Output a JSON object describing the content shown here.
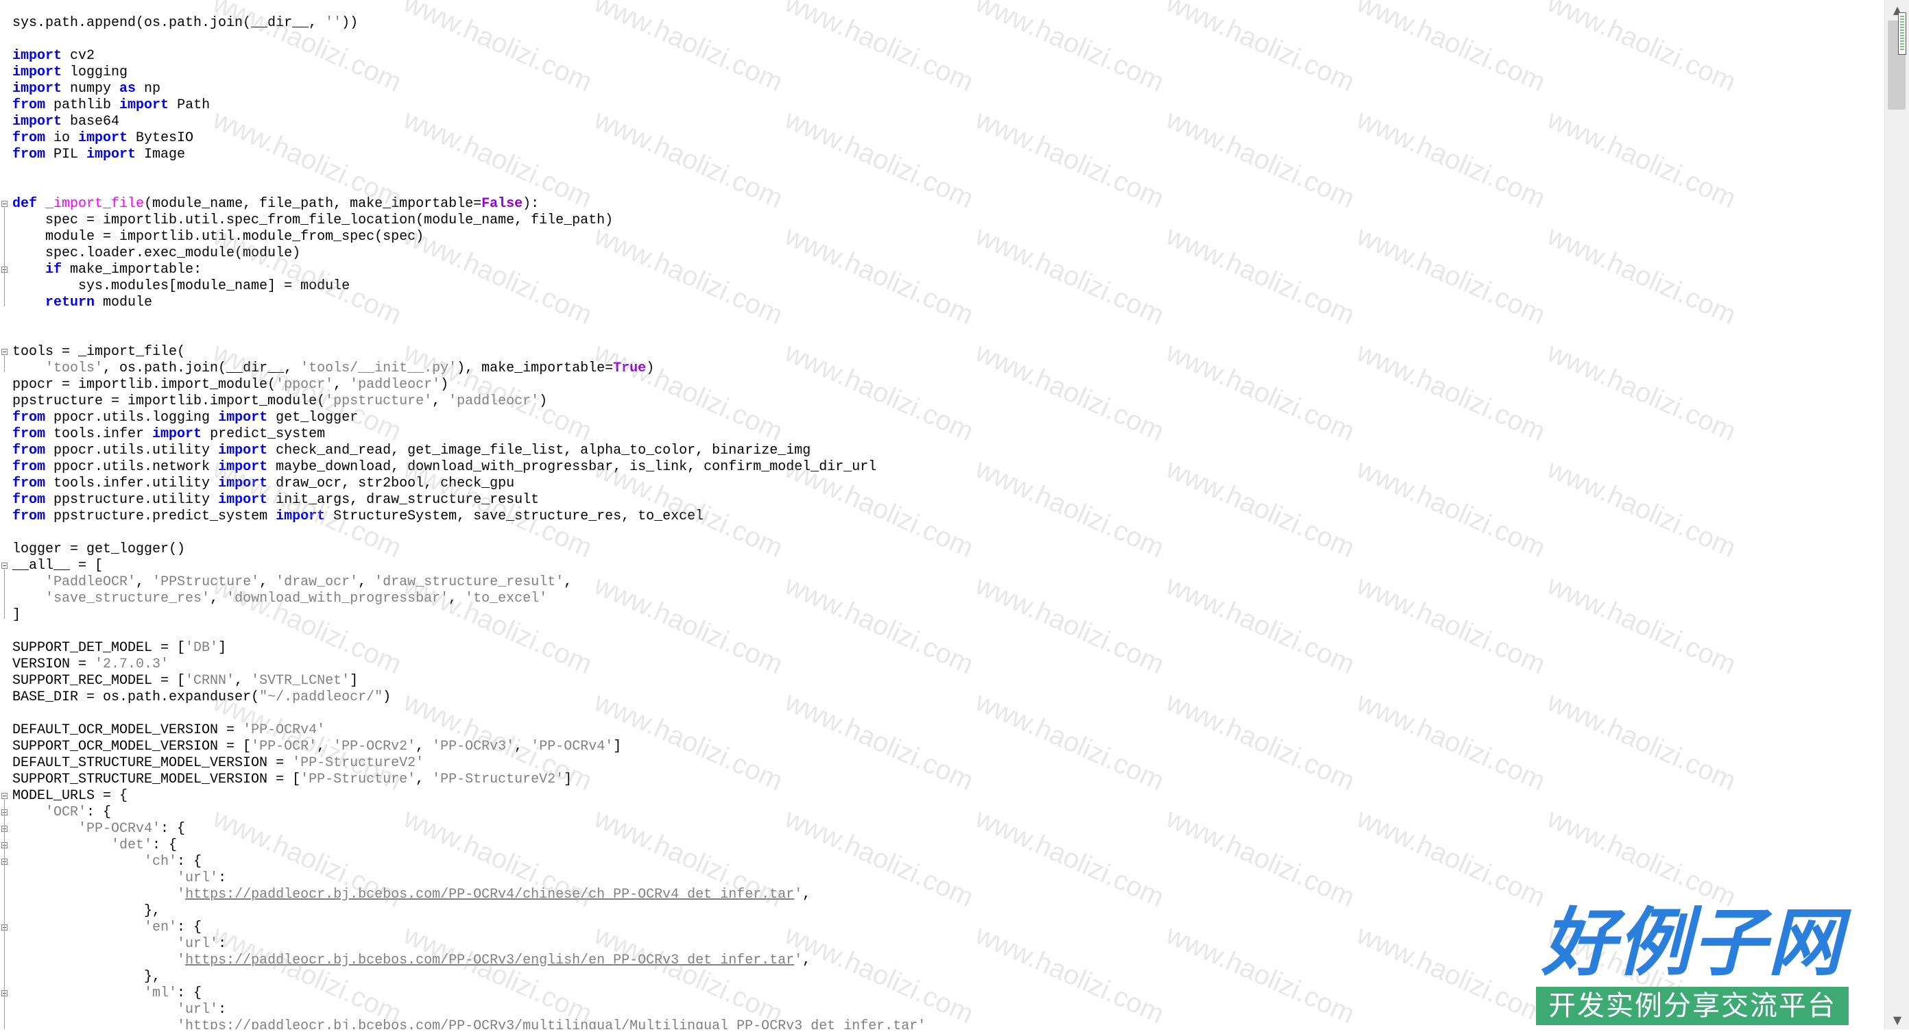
{
  "code_lines": [
    [
      [
        "sys.path.append(os.path.join(__dir__, ",
        ""
      ],
      [
        "''",
        "str"
      ],
      [
        "))",
        ""
      ]
    ],
    [],
    [
      [
        "import",
        "kw"
      ],
      [
        " cv2",
        ""
      ]
    ],
    [
      [
        "import",
        "kw"
      ],
      [
        " logging",
        ""
      ]
    ],
    [
      [
        "import",
        "kw"
      ],
      [
        " numpy ",
        ""
      ],
      [
        "as",
        "kw"
      ],
      [
        " np",
        ""
      ]
    ],
    [
      [
        "from",
        "kw"
      ],
      [
        " pathlib ",
        ""
      ],
      [
        "import",
        "kw"
      ],
      [
        " Path",
        ""
      ]
    ],
    [
      [
        "import",
        "kw"
      ],
      [
        " base64",
        ""
      ]
    ],
    [
      [
        "from",
        "kw"
      ],
      [
        " io ",
        ""
      ],
      [
        "import",
        "kw"
      ],
      [
        " BytesIO",
        ""
      ]
    ],
    [
      [
        "from",
        "kw"
      ],
      [
        " PIL ",
        ""
      ],
      [
        "import",
        "kw"
      ],
      [
        " Image",
        ""
      ]
    ],
    [],
    [],
    [
      [
        "def",
        "kw"
      ],
      [
        " ",
        ""
      ],
      [
        "_import_file",
        "fn"
      ],
      [
        "(module_name, file_path, make_importable=",
        ""
      ],
      [
        "False",
        "kw2"
      ],
      [
        "):",
        ""
      ]
    ],
    [
      [
        "    spec = importlib.util.spec_from_file_location(module_name, file_path)",
        ""
      ]
    ],
    [
      [
        "    module = importlib.util.module_from_spec(spec)",
        ""
      ]
    ],
    [
      [
        "    spec.loader.exec_module(module)",
        ""
      ]
    ],
    [
      [
        "    ",
        ""
      ],
      [
        "if",
        "kw"
      ],
      [
        " make_importable:",
        ""
      ]
    ],
    [
      [
        "        sys.modules[module_name] = module",
        ""
      ]
    ],
    [
      [
        "    ",
        ""
      ],
      [
        "return",
        "kw"
      ],
      [
        " module",
        ""
      ]
    ],
    [],
    [],
    [
      [
        "tools = _import_file(",
        ""
      ]
    ],
    [
      [
        "    ",
        ""
      ],
      [
        "'tools'",
        "str"
      ],
      [
        ", os.path.join(__dir__, ",
        ""
      ],
      [
        "'tools/__init__.py'",
        "str"
      ],
      [
        "), make_importable=",
        ""
      ],
      [
        "True",
        "kw2"
      ],
      [
        ")",
        ""
      ]
    ],
    [
      [
        "ppocr = importlib.import_module(",
        ""
      ],
      [
        "'ppocr'",
        "str"
      ],
      [
        ", ",
        ""
      ],
      [
        "'paddleocr'",
        "str"
      ],
      [
        ")",
        ""
      ]
    ],
    [
      [
        "ppstructure = importlib.import_module(",
        ""
      ],
      [
        "'ppstructure'",
        "str"
      ],
      [
        ", ",
        ""
      ],
      [
        "'paddleocr'",
        "str"
      ],
      [
        ")",
        ""
      ]
    ],
    [
      [
        "from",
        "kw"
      ],
      [
        " ppocr.utils.logging ",
        ""
      ],
      [
        "import",
        "kw"
      ],
      [
        " get_logger",
        ""
      ]
    ],
    [
      [
        "from",
        "kw"
      ],
      [
        " tools.infer ",
        ""
      ],
      [
        "import",
        "kw"
      ],
      [
        " predict_system",
        ""
      ]
    ],
    [
      [
        "from",
        "kw"
      ],
      [
        " ppocr.utils.utility ",
        ""
      ],
      [
        "import",
        "kw"
      ],
      [
        " check_and_read, get_image_file_list, alpha_to_color, binarize_img",
        ""
      ]
    ],
    [
      [
        "from",
        "kw"
      ],
      [
        " ppocr.utils.network ",
        ""
      ],
      [
        "import",
        "kw"
      ],
      [
        " maybe_download, download_with_progressbar, is_link, confirm_model_dir_url",
        ""
      ]
    ],
    [
      [
        "from",
        "kw"
      ],
      [
        " tools.infer.utility ",
        ""
      ],
      [
        "import",
        "kw"
      ],
      [
        " draw_ocr, str2bool, check_gpu",
        ""
      ]
    ],
    [
      [
        "from",
        "kw"
      ],
      [
        " ppstructure.utility ",
        ""
      ],
      [
        "import",
        "kw"
      ],
      [
        " init_args, draw_structure_result",
        ""
      ]
    ],
    [
      [
        "from",
        "kw"
      ],
      [
        " ppstructure.predict_system ",
        ""
      ],
      [
        "import",
        "kw"
      ],
      [
        " StructureSystem, save_structure_res, to_excel",
        ""
      ]
    ],
    [],
    [
      [
        "logger = get_logger()",
        ""
      ]
    ],
    [
      [
        "__all__ = [",
        ""
      ]
    ],
    [
      [
        "    ",
        ""
      ],
      [
        "'PaddleOCR'",
        "str"
      ],
      [
        ", ",
        ""
      ],
      [
        "'PPStructure'",
        "str"
      ],
      [
        ", ",
        ""
      ],
      [
        "'draw_ocr'",
        "str"
      ],
      [
        ", ",
        ""
      ],
      [
        "'draw_structure_result'",
        "str"
      ],
      [
        ",",
        ""
      ]
    ],
    [
      [
        "    ",
        ""
      ],
      [
        "'save_structure_res'",
        "str"
      ],
      [
        ", ",
        ""
      ],
      [
        "'download_with_progressbar'",
        "str"
      ],
      [
        ", ",
        ""
      ],
      [
        "'to_excel'",
        "str"
      ]
    ],
    [
      [
        "]",
        ""
      ]
    ],
    [],
    [
      [
        "SUPPORT_DET_MODEL = [",
        ""
      ],
      [
        "'DB'",
        "str"
      ],
      [
        "]",
        ""
      ]
    ],
    [
      [
        "VERSION = ",
        ""
      ],
      [
        "'2.7.0.3'",
        "str"
      ]
    ],
    [
      [
        "SUPPORT_REC_MODEL = [",
        ""
      ],
      [
        "'CRNN'",
        "str"
      ],
      [
        ", ",
        ""
      ],
      [
        "'SVTR_LCNet'",
        "str"
      ],
      [
        "]",
        ""
      ]
    ],
    [
      [
        "BASE_DIR = os.path.expanduser(",
        ""
      ],
      [
        "\"~/.paddleocr/\"",
        "str"
      ],
      [
        ")",
        ""
      ]
    ],
    [],
    [
      [
        "DEFAULT_OCR_MODEL_VERSION = ",
        ""
      ],
      [
        "'PP-OCRv4'",
        "str"
      ]
    ],
    [
      [
        "SUPPORT_OCR_MODEL_VERSION = [",
        ""
      ],
      [
        "'PP-OCR'",
        "str"
      ],
      [
        ", ",
        ""
      ],
      [
        "'PP-OCRv2'",
        "str"
      ],
      [
        ", ",
        ""
      ],
      [
        "'PP-OCRv3'",
        "str"
      ],
      [
        ", ",
        ""
      ],
      [
        "'PP-OCRv4'",
        "str"
      ],
      [
        "]",
        ""
      ]
    ],
    [
      [
        "DEFAULT_STRUCTURE_MODEL_VERSION = ",
        ""
      ],
      [
        "'PP-StructureV2'",
        "str"
      ]
    ],
    [
      [
        "SUPPORT_STRUCTURE_MODEL_VERSION = [",
        ""
      ],
      [
        "'PP-Structure'",
        "str"
      ],
      [
        ", ",
        ""
      ],
      [
        "'PP-StructureV2'",
        "str"
      ],
      [
        "]",
        ""
      ]
    ],
    [
      [
        "MODEL_URLS = {",
        ""
      ]
    ],
    [
      [
        "    ",
        ""
      ],
      [
        "'OCR'",
        "str"
      ],
      [
        ": {",
        ""
      ]
    ],
    [
      [
        "        ",
        ""
      ],
      [
        "'PP-OCRv4'",
        "str"
      ],
      [
        ": {",
        ""
      ]
    ],
    [
      [
        "            ",
        ""
      ],
      [
        "'det'",
        "str"
      ],
      [
        ": {",
        ""
      ]
    ],
    [
      [
        "                ",
        ""
      ],
      [
        "'ch'",
        "str"
      ],
      [
        ": {",
        ""
      ]
    ],
    [
      [
        "                    ",
        ""
      ],
      [
        "'url'",
        "str"
      ],
      [
        ":",
        ""
      ]
    ],
    [
      [
        "                    ",
        ""
      ],
      [
        "'",
        "str"
      ],
      [
        "https://paddleocr.bj.bcebos.com/PP-OCRv4/chinese/ch_PP-OCRv4_det_infer.tar",
        "url"
      ],
      [
        "'",
        "str"
      ],
      [
        ",",
        ""
      ]
    ],
    [
      [
        "                },",
        ""
      ]
    ],
    [
      [
        "                ",
        ""
      ],
      [
        "'en'",
        "str"
      ],
      [
        ": {",
        ""
      ]
    ],
    [
      [
        "                    ",
        ""
      ],
      [
        "'url'",
        "str"
      ],
      [
        ":",
        ""
      ]
    ],
    [
      [
        "                    ",
        ""
      ],
      [
        "'",
        "str"
      ],
      [
        "https://paddleocr.bj.bcebos.com/PP-OCRv3/english/en_PP-OCRv3_det_infer.tar",
        "url"
      ],
      [
        "'",
        "str"
      ],
      [
        ",",
        ""
      ]
    ],
    [
      [
        "                },",
        ""
      ]
    ],
    [
      [
        "                ",
        ""
      ],
      [
        "'ml'",
        "str"
      ],
      [
        ": {",
        ""
      ]
    ],
    [
      [
        "                    ",
        ""
      ],
      [
        "'url'",
        "str"
      ],
      [
        ":",
        ""
      ]
    ],
    [
      [
        "                    ",
        ""
      ],
      [
        "'https://paddleocr.bj.bcebos.com/PP-OCRv3/multilingual/Multilingual_PP-OCRv3_det_infer.tar'",
        "str"
      ]
    ]
  ],
  "watermark_text": "www.haolizi.com",
  "logo": {
    "main": "好例子网",
    "sub": "开发实例分享交流平台"
  },
  "scrollbar": {
    "up_icon": "chevron-up-icon",
    "down_icon": "chevron-down-icon"
  },
  "colors": {
    "keyword": "#0000ff",
    "builtin_const": "#9400d3",
    "function_name": "#ff00ff",
    "string": "#808080",
    "logo_blue": "#2a7fdc",
    "logo_green": "#3daa74"
  }
}
